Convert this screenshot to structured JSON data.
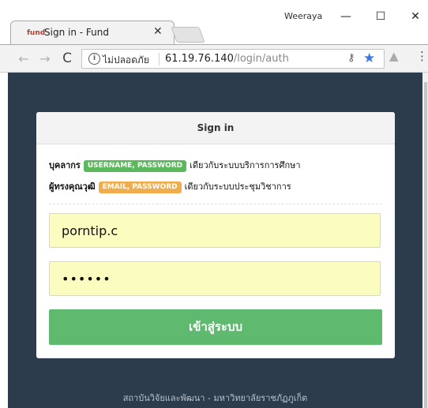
{
  "window": {
    "user_name": "Weeraya",
    "minimize_glyph": "—",
    "maximize_glyph": "☐",
    "close_glyph": "✕"
  },
  "tab": {
    "favicon_text": "fund",
    "title": "Sign in - Fund",
    "close_glyph": "✕"
  },
  "toolbar": {
    "back_glyph": "←",
    "forward_glyph": "→",
    "reload_glyph": "C",
    "security_label": "ไม่ปลอดภัย",
    "url_host": "61.19.76.140",
    "url_path": "/login/auth",
    "key_glyph": "⚷",
    "star_glyph": "★",
    "extension_glyph": "▲",
    "menu_glyph": "⋮"
  },
  "card": {
    "header": "Sign in",
    "staff_role": "บุคลากร",
    "staff_badge": "USERNAME, PASSWORD",
    "staff_desc": "เดียวกับระบบบริการการศึกษา",
    "expert_role": "ผู้ทรงคุณวุฒิ",
    "expert_badge": "EMAIL, PASSWORD",
    "expert_desc": "เดียวกับระบบประชุมวิชาการ"
  },
  "form": {
    "username_value": "porntip.c",
    "password_value": "••••••",
    "submit_label": "เข้าสู่ระบบ"
  },
  "footer": {
    "text": "สถาบันวิจัยและพัฒนา - มหาวิทยาลัยราชภัฏภูเก็ต"
  },
  "colors": {
    "page_background": "#2d3c4d",
    "submit_button": "#5fba6f",
    "badge_green": "#5cb85c",
    "badge_orange": "#f0ad4e",
    "input_background": "#fafcc0"
  }
}
